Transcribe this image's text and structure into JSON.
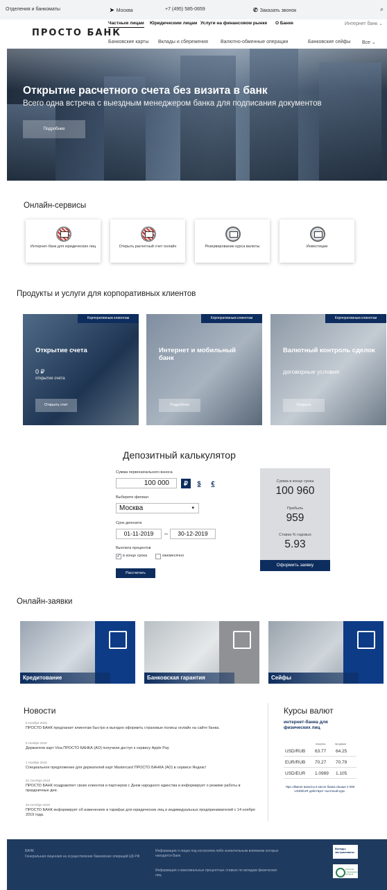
{
  "topbar": {
    "offices": "Отделения и банкоматы",
    "city_icon": "location-arrow-icon",
    "city": "Москва",
    "phone": "+7 (495) 585-0659",
    "callback_icon": "phone-icon",
    "callback": "Заказать звонок",
    "search_icon": "search-icon"
  },
  "header": {
    "logo": "ПРОСТО БАНК",
    "nav": [
      "Частным лицам",
      "Юридическим лицам",
      "Услуги на финансовом рынке",
      "О Банке"
    ],
    "internet_bank": "Интернет банк ⌄",
    "subnav": [
      "Банковские карты",
      "Вклады и сбережения",
      "Валютно-обменные операции",
      "Банковские сейфы",
      "Все ⌄"
    ]
  },
  "hero": {
    "title": "Открытие расчетного счета без визита в банк",
    "subtitle": "Всего одна встреча с выездным менеджером банка для подписания документов",
    "button": "Подробнее"
  },
  "online_services": {
    "title": "Онлайн-сервисы",
    "items": [
      {
        "label": "Интернет-банк для юридических лиц",
        "icon": "internet-bank-icon"
      },
      {
        "label": "Открыть расчетный счет онлайн",
        "icon": "open-account-icon"
      },
      {
        "label": "Резервирование курса валюты",
        "icon": "currency-reserve-icon"
      },
      {
        "label": "Инвестиции",
        "icon": "investments-icon"
      }
    ]
  },
  "products": {
    "title": "Продукты и услуги для корпоративных клиентов",
    "items": [
      {
        "badge": "Корпоративным клиентам",
        "title": "Открытие счета",
        "value": "0 ₽",
        "sub": "открытие счета",
        "button": "Открыть счет"
      },
      {
        "badge": "Корпоративным клиентам",
        "title": "Интернет и мобильный банк",
        "value": "",
        "sub": "",
        "button": "Подробнее"
      },
      {
        "badge": "Корпоративным клиентам",
        "title": "Валютный контроль сделок",
        "value": "договорные условия",
        "sub": "",
        "button": "Открыть"
      }
    ]
  },
  "calculator": {
    "title": "Депозитный калькулятор",
    "amount_label": "Сумма первоначального взноса",
    "amount": "100 000",
    "currencies": [
      "₽",
      "$",
      "€"
    ],
    "branch_label": "Выберите филиал",
    "branch": "Москва",
    "term_label": "Срок депозита",
    "date_from": "01-11-2019",
    "dash": "–",
    "date_to": "30-12-2019",
    "payout_label": "Выплата процентов",
    "opt_end": "в конце срока",
    "opt_month": "ежемесячно",
    "calc_button": "Рассчитать",
    "result_total_label": "Сумма в конце срока",
    "result_total": "100 960",
    "result_profit_label": "Прибыль",
    "result_profit": "959",
    "result_rate_label": "Ставка % годовых",
    "result_rate": "5.93",
    "apply_button": "Оформить заявку"
  },
  "requests": {
    "title": "Онлайн-заявки",
    "items": [
      {
        "label": "Кредитование",
        "icon": "card-icon"
      },
      {
        "label": "Банковская гарантия",
        "icon": "shield-check-icon"
      },
      {
        "label": "Сейфы",
        "icon": "safe-icon"
      }
    ]
  },
  "news": {
    "title": "Новости",
    "items": [
      {
        "date": "6 Ноября 2019",
        "text": "ПРОСТО БАНК предлагает клиентам быстро и выгодно оформить страховые полисы онлайн на сайте банка."
      },
      {
        "date": "5 Ноября 2019",
        "text": "Держатели карт Visa ПРОСТО БАНКА (АО) получили доступ к сервису Apple Pay"
      },
      {
        "date": "1 Ноября 2019",
        "text": "Специальное предложение для держателей карт Mastercard ПРОСТО БАНКА (АО) в сервисе Яндекс!"
      },
      {
        "date": "31 Октября 2019",
        "text": "ПРОСТО БАНК поздравляет своих клиентов и партнеров с Днем народного единства и информирует о режиме работы в праздничные дни."
      },
      {
        "date": "25 Октября 2019",
        "text": "ПРОСТО БАНК информирует об изменениях в тарифах для юридических лиц и индивидуальных предпринимателей с 14 ноября 2019 года."
      }
    ]
  },
  "rates": {
    "title": "Курсы валют",
    "subtitle": "интернет-банка для физических лиц",
    "col_buy": "покупка",
    "col_sell": "продажа",
    "rows": [
      {
        "pair": "USD/RUB",
        "buy": "63.77",
        "sell": "64.25"
      },
      {
        "pair": "EUR/RUB",
        "buy": "70.27",
        "sell": "70.79"
      },
      {
        "pair": "USD/EUR",
        "buy": "1.0989",
        "sell": "1.105"
      }
    ],
    "note": "При обмене валюты в кассе банка свыше 2 000 USD/EUR действует льготный курс."
  },
  "footer": {
    "bank": "БАНК",
    "license": "Генеральная лицензия на осуществление банковских операций ЦБ РФ",
    "info1": "Информация о лицах под контролем либо значительным влиянием которых находится Банк",
    "info2": "Информация о максимальных процентных ставках по вкладам физических лиц",
    "deposit_badge": "Вклады застрахованы",
    "insurance_badge": "Система страхования вкладов"
  },
  "colors": {
    "brand_navy": "#0d2d5e",
    "footer": "#1f3a5f",
    "accent_red": "#c9342f"
  }
}
